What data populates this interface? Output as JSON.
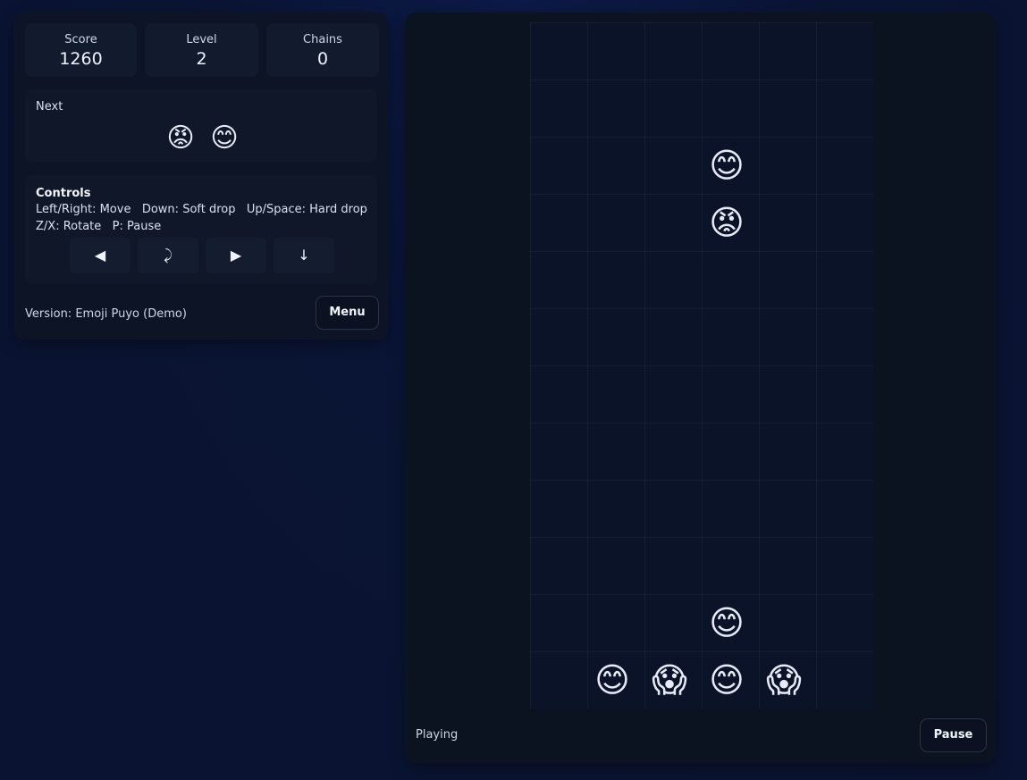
{
  "stats": [
    {
      "label": "Score",
      "value": "1260"
    },
    {
      "label": "Level",
      "value": "2"
    },
    {
      "label": "Chains",
      "value": "0"
    }
  ],
  "next": {
    "label": "Next",
    "pieces": [
      "😡",
      "😊"
    ]
  },
  "controls": {
    "title": "Controls",
    "line1": "Left/Right: Move   Down: Soft drop   Up/Space: Hard drop",
    "line2": "Z/X: Rotate   P: Pause",
    "buttons": [
      {
        "glyph": "◀",
        "icon": "left-arrow-icon"
      },
      {
        "glyph": "⤸",
        "icon": "rotate-icon"
      },
      {
        "glyph": "▶",
        "icon": "right-arrow-icon"
      },
      {
        "glyph": "↓",
        "icon": "down-arrow-icon"
      }
    ]
  },
  "footer": {
    "version": "Version: Emoji Puyo (Demo)",
    "menu_label": "Menu"
  },
  "board": {
    "columns": 6,
    "rows": 12,
    "falling_piece": [
      {
        "col": 3,
        "row": 2,
        "emoji": "😊",
        "name": "smiling-face"
      },
      {
        "col": 3,
        "row": 3,
        "emoji": "😡",
        "name": "angry-face"
      }
    ],
    "settled": [
      {
        "col": 3,
        "row": 10,
        "emoji": "😊",
        "name": "smiling-face"
      },
      {
        "col": 1,
        "row": 11,
        "emoji": "😊",
        "name": "smiling-face"
      },
      {
        "col": 2,
        "row": 11,
        "emoji": "😱",
        "name": "screaming-face"
      },
      {
        "col": 3,
        "row": 11,
        "emoji": "😊",
        "name": "smiling-face"
      },
      {
        "col": 4,
        "row": 11,
        "emoji": "😱",
        "name": "screaming-face"
      }
    ]
  },
  "game": {
    "status": "Playing",
    "pause_label": "Pause"
  }
}
